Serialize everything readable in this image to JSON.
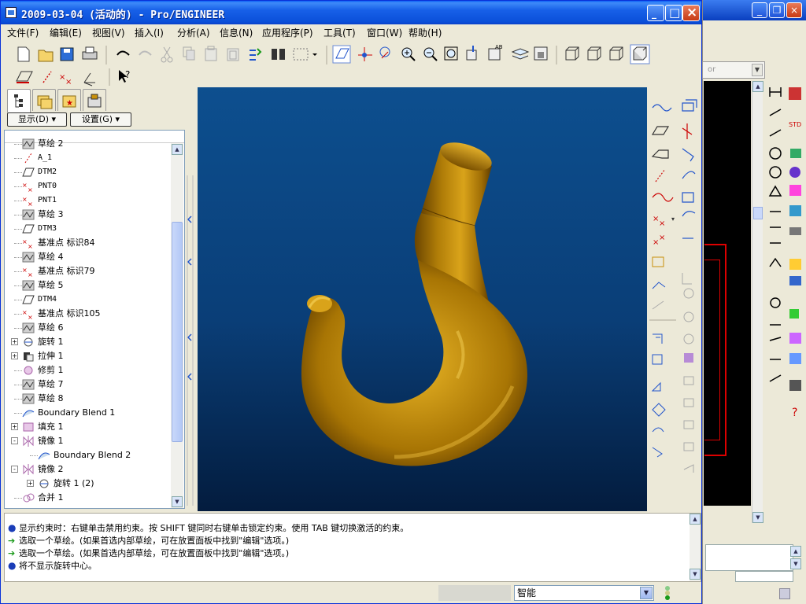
{
  "window": {
    "title": "2009-03-04 (活动的) - Pro/ENGINEER",
    "minimize": "_",
    "maximize": "□",
    "close": "×"
  },
  "menu": [
    {
      "label": "文件(F)"
    },
    {
      "label": "编辑(E)"
    },
    {
      "label": "视图(V)"
    },
    {
      "label": "插入(I)"
    },
    {
      "label": "分析(A)"
    },
    {
      "label": "信息(N)"
    },
    {
      "label": "应用程序(P)"
    },
    {
      "label": "工具(T)"
    },
    {
      "label": "窗口(W)"
    },
    {
      "label": "帮助(H)"
    }
  ],
  "panel": {
    "show_label": "显示(D) ▾",
    "settings_label": "设置(G) ▾"
  },
  "tree": [
    {
      "label": "草绘 2",
      "icon": "sketch",
      "indent": 0,
      "expander": ""
    },
    {
      "label": "A_1",
      "icon": "axis",
      "indent": 0,
      "expander": ""
    },
    {
      "label": "DTM2",
      "icon": "plane",
      "indent": 0,
      "expander": ""
    },
    {
      "label": "PNT0",
      "icon": "point",
      "indent": 0,
      "expander": ""
    },
    {
      "label": "PNT1",
      "icon": "point",
      "indent": 0,
      "expander": ""
    },
    {
      "label": "草绘 3",
      "icon": "sketch",
      "indent": 0,
      "expander": ""
    },
    {
      "label": "DTM3",
      "icon": "plane",
      "indent": 0,
      "expander": ""
    },
    {
      "label": "基准点 标识84",
      "icon": "point",
      "indent": 0,
      "expander": ""
    },
    {
      "label": "草绘 4",
      "icon": "sketch",
      "indent": 0,
      "expander": ""
    },
    {
      "label": "基准点 标识79",
      "icon": "point",
      "indent": 0,
      "expander": ""
    },
    {
      "label": "草绘 5",
      "icon": "sketch",
      "indent": 0,
      "expander": ""
    },
    {
      "label": "DTM4",
      "icon": "plane",
      "indent": 0,
      "expander": ""
    },
    {
      "label": "基准点 标识105",
      "icon": "point",
      "indent": 0,
      "expander": ""
    },
    {
      "label": "草绘 6",
      "icon": "sketch",
      "indent": 0,
      "expander": ""
    },
    {
      "label": "旋转 1",
      "icon": "revolve",
      "indent": 0,
      "expander": "+"
    },
    {
      "label": "拉伸 1",
      "icon": "extrude",
      "indent": 0,
      "expander": "+"
    },
    {
      "label": "修剪 1",
      "icon": "trim",
      "indent": 0,
      "expander": ""
    },
    {
      "label": "草绘 7",
      "icon": "sketch",
      "indent": 0,
      "expander": ""
    },
    {
      "label": "草绘 8",
      "icon": "sketch",
      "indent": 0,
      "expander": ""
    },
    {
      "label": "Boundary Blend 1",
      "icon": "blend",
      "indent": 0,
      "expander": ""
    },
    {
      "label": "填充 1",
      "icon": "fill",
      "indent": 0,
      "expander": "+"
    },
    {
      "label": "镜像 1",
      "icon": "mirror",
      "indent": 0,
      "expander": "-"
    },
    {
      "label": "Boundary Blend 2",
      "icon": "blend",
      "indent": 1,
      "expander": ""
    },
    {
      "label": "镜像 2",
      "icon": "mirror",
      "indent": 0,
      "expander": "-"
    },
    {
      "label": "旋转 1 (2)",
      "icon": "revolve",
      "indent": 1,
      "expander": "+"
    },
    {
      "label": "合并 1",
      "icon": "merge",
      "indent": 0,
      "expander": ""
    }
  ],
  "messages": [
    {
      "type": "info",
      "text": "显示约束时：右键单击禁用约束。按 SHIFT 键同时右键单击锁定约束。使用 TAB 键切换激活的约束。"
    },
    {
      "type": "prompt",
      "text": "选取一个草绘。(如果首选内部草绘，可在放置面板中找到\"编辑\"选项。)"
    },
    {
      "type": "prompt",
      "text": "选取一个草绘。(如果首选内部草绘，可在放置面板中找到\"编辑\"选项。)"
    },
    {
      "type": "info",
      "text": "将不显示旋转中心。"
    }
  ],
  "status": {
    "filter_value": "智能"
  },
  "bg_window": {
    "combo_text": "or"
  },
  "colors": {
    "model": "#c8900a",
    "viewport_top": "#0d4f8f",
    "viewport_bottom": "#031c3e",
    "titlebar": "#0a4fd9"
  }
}
